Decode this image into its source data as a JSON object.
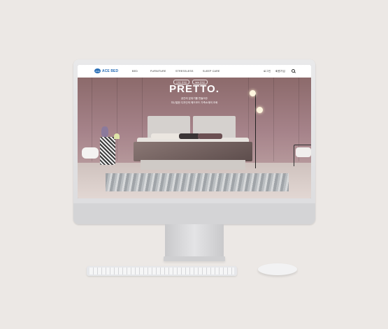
{
  "site": {
    "logo_badge": "ACE",
    "logo_text": "ACE BED",
    "nav": [
      "BED",
      "FURNITURE",
      "STRESSLESS",
      "SLEEP CARE"
    ],
    "right_links": [
      "로그인",
      "회원가입"
    ]
  },
  "hero": {
    "pills": [
      "프레토 컬렉션",
      "NEW 컬렉션"
    ],
    "title": "PRETTO.",
    "sub1": "공간의 분위기를 만들어주",
    "sub2": "미니멀한 디자인의 헤드보드 가죽소재의 조화"
  },
  "icons": {
    "search": "search-icon",
    "camera": "camera-icon"
  },
  "colors": {
    "brand": "#2a6fb7",
    "hero_wall": "#a6838a"
  }
}
